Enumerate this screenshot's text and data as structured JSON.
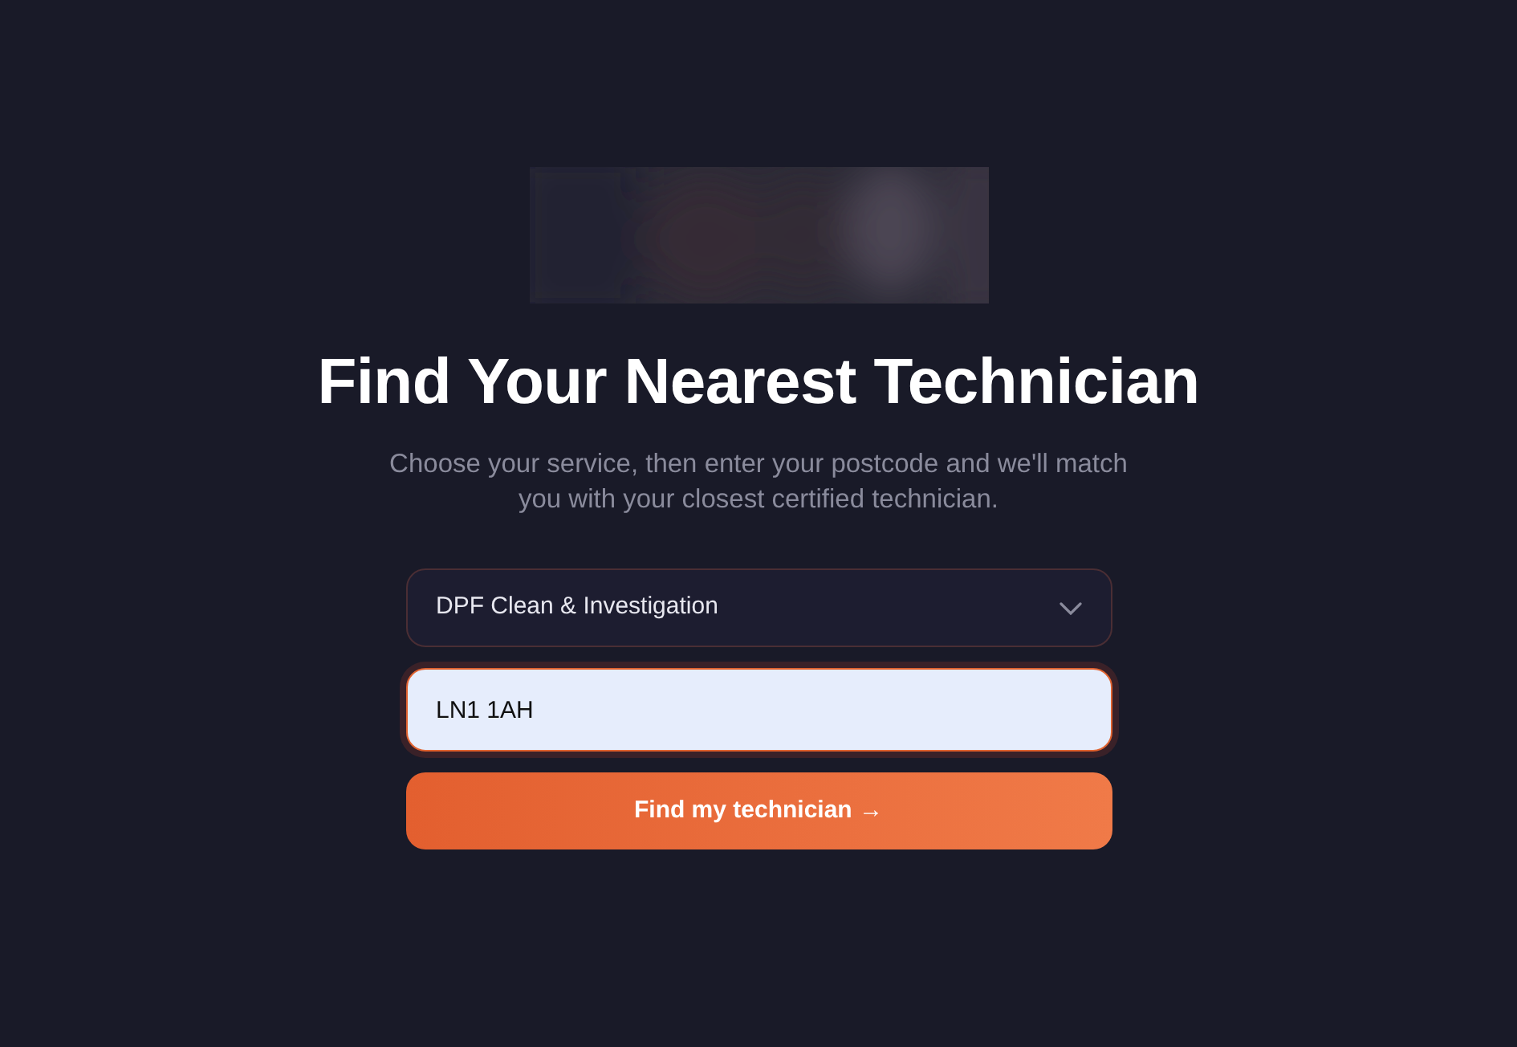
{
  "title": "Find Your Nearest Technician",
  "subtitle": "Choose your service, then enter your postcode and we'll match you with your closest certified technician.",
  "service_select": {
    "value": "DPF Clean & Investigation"
  },
  "postcode_field": {
    "value": "LN1 1AH",
    "focused": true
  },
  "submit_button": {
    "label": "Find my technician →"
  }
}
